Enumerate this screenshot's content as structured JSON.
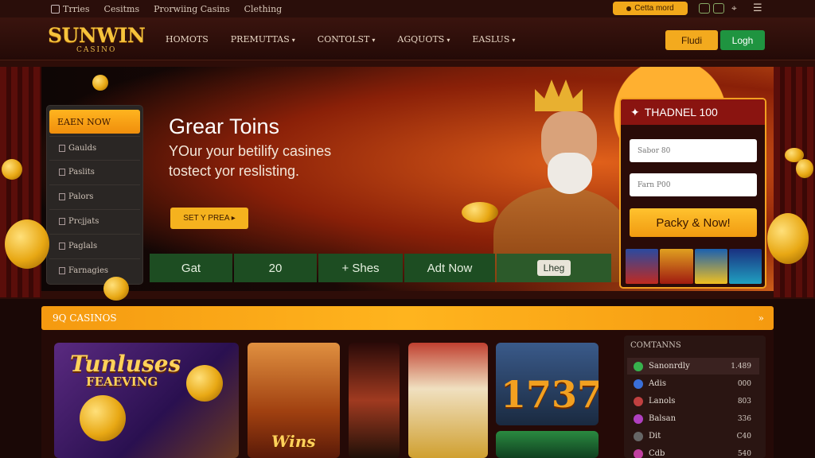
{
  "topbar": {
    "links": [
      "Trries",
      "Cesitms",
      "Prorwiing Casins",
      "Clething"
    ],
    "promo_label": "Cetta mord"
  },
  "nav": {
    "brand": "SUNWIN",
    "brand_sub": "CASINO",
    "links": [
      {
        "label": "HOMOTS",
        "dropdown": false
      },
      {
        "label": "PREMUTTAS",
        "dropdown": true
      },
      {
        "label": "CONTOLST",
        "dropdown": true
      },
      {
        "label": "AGQUOTS",
        "dropdown": true
      },
      {
        "label": "EASLUS",
        "dropdown": true
      }
    ],
    "find_label": "Fludi",
    "login_label": "Logh"
  },
  "sidemenu": {
    "head": "EAEN NOW",
    "items": [
      "Gaulds",
      "Paslits",
      "Palors",
      "Prcjjats",
      "Paglals",
      "Farnagies"
    ]
  },
  "hero": {
    "title": "Grear Toins",
    "subtitle_line1": "YOur your betilify casines",
    "subtitle_line2": "tostect yor reslisting.",
    "cta_label": "SET Y PREA ▸"
  },
  "strip": {
    "cells": [
      "Gat",
      "20",
      "+ Shes",
      "Adt Now"
    ],
    "button_label": "Lheg"
  },
  "signup": {
    "title": "THADNEL 100",
    "field1_placeholder": "Sabor 80",
    "field2_placeholder": "Farn P00",
    "submit_label": "Packy & Now!"
  },
  "games": {
    "section_title": "9Q CASINOS",
    "tiles": [
      {
        "label_line1": "Tunluses",
        "label_line2": "FEAEVING"
      },
      {
        "label_line1": "Wins"
      },
      {
        "label_line1": ""
      },
      {
        "label_line1": ""
      },
      {
        "label_line1": "1737"
      }
    ]
  },
  "sidelist": {
    "title": "COMTANNS",
    "rows": [
      {
        "label": "Sanonrdly",
        "value": "1.489",
        "color": "#37b24d"
      },
      {
        "label": "Adis",
        "value": "000",
        "color": "#3a6fd8"
      },
      {
        "label": "Lanols",
        "value": "803",
        "color": "#c04040"
      },
      {
        "label": "Balsan",
        "value": "336",
        "color": "#b040c0"
      },
      {
        "label": "Dit",
        "value": "C40",
        "color": "#666666"
      },
      {
        "label": "Cdb",
        "value": "540",
        "color": "#c040a0"
      }
    ]
  }
}
